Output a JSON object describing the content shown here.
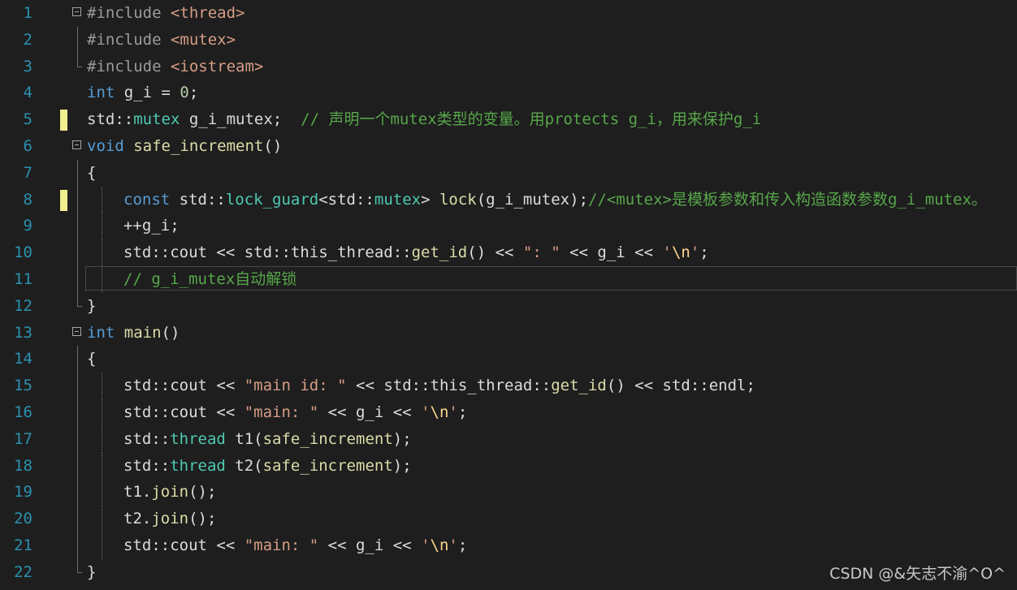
{
  "editor": {
    "lines": [
      {
        "n": "1",
        "fold": true,
        "tokens": [
          [
            "pp",
            "#include "
          ],
          [
            "hd",
            "<thread>"
          ]
        ]
      },
      {
        "n": "2",
        "tokens": [
          [
            "pp",
            "#include "
          ],
          [
            "hd",
            "<mutex>"
          ]
        ]
      },
      {
        "n": "3",
        "tokens": [
          [
            "pp",
            "#include "
          ],
          [
            "hd",
            "<iostream>"
          ]
        ]
      },
      {
        "n": "4",
        "tokens": [
          [
            "kw",
            "int"
          ],
          [
            "tx",
            " g_i = "
          ],
          [
            "nm",
            "0"
          ],
          [
            "tx",
            ";"
          ]
        ]
      },
      {
        "n": "5",
        "mark": true,
        "tokens": [
          [
            "tx",
            "std::"
          ],
          [
            "ty",
            "mutex"
          ],
          [
            "tx",
            " g_i_mutex;  "
          ],
          [
            "cm",
            "// 声明一个mutex类型的变量。用protects g_i，用来保护g_i"
          ]
        ]
      },
      {
        "n": "6",
        "fold": true,
        "tokens": [
          [
            "kw",
            "void"
          ],
          [
            "tx",
            " "
          ],
          [
            "fn",
            "safe_increment"
          ],
          [
            "tx",
            "()"
          ]
        ]
      },
      {
        "n": "7",
        "tokens": [
          [
            "tx",
            "{"
          ]
        ]
      },
      {
        "n": "8",
        "mark": true,
        "indent": true,
        "tokens": [
          [
            "kw",
            "const"
          ],
          [
            "tx",
            " std::"
          ],
          [
            "ty",
            "lock_guard"
          ],
          [
            "tx",
            "<std::"
          ],
          [
            "ty",
            "mutex"
          ],
          [
            "tx",
            "> "
          ],
          [
            "fn",
            "lock"
          ],
          [
            "tx",
            "(g_i_mutex);"
          ],
          [
            "cm",
            "//<mutex>是模板参数和传入构造函数参数g_i_mutex。"
          ]
        ]
      },
      {
        "n": "9",
        "indent": true,
        "tokens": [
          [
            "tx",
            "++g_i;"
          ]
        ]
      },
      {
        "n": "10",
        "indent": true,
        "tokens": [
          [
            "tx",
            "std::cout << std::this_thread::"
          ],
          [
            "fn",
            "get_id"
          ],
          [
            "tx",
            "() << "
          ],
          [
            "st",
            "\": \""
          ],
          [
            "tx",
            " << g_i << "
          ],
          [
            "st",
            "'"
          ],
          [
            "es",
            "\\n"
          ],
          [
            "st",
            "'"
          ],
          [
            "tx",
            ";"
          ]
        ]
      },
      {
        "n": "11",
        "indent": true,
        "current": true,
        "tokens": [
          [
            "cm",
            "// g_i_mutex自动解锁"
          ]
        ]
      },
      {
        "n": "12",
        "tokens": [
          [
            "tx",
            "}"
          ]
        ]
      },
      {
        "n": "13",
        "fold": true,
        "tokens": [
          [
            "kw",
            "int"
          ],
          [
            "tx",
            " "
          ],
          [
            "fn",
            "main"
          ],
          [
            "tx",
            "()"
          ]
        ]
      },
      {
        "n": "14",
        "tokens": [
          [
            "tx",
            "{"
          ]
        ]
      },
      {
        "n": "15",
        "indent": true,
        "tokens": [
          [
            "tx",
            "std::cout << "
          ],
          [
            "st",
            "\"main id: \""
          ],
          [
            "tx",
            " << std::this_thread::"
          ],
          [
            "fn",
            "get_id"
          ],
          [
            "tx",
            "() << std::endl;"
          ]
        ]
      },
      {
        "n": "16",
        "indent": true,
        "tokens": [
          [
            "tx",
            "std::cout << "
          ],
          [
            "st",
            "\"main: \""
          ],
          [
            "tx",
            " << g_i << "
          ],
          [
            "st",
            "'"
          ],
          [
            "es",
            "\\n"
          ],
          [
            "st",
            "'"
          ],
          [
            "tx",
            ";"
          ]
        ]
      },
      {
        "n": "17",
        "indent": true,
        "tokens": [
          [
            "tx",
            "std::"
          ],
          [
            "ty",
            "thread"
          ],
          [
            "tx",
            " t1("
          ],
          [
            "fn",
            "safe_increment"
          ],
          [
            "tx",
            ");"
          ]
        ]
      },
      {
        "n": "18",
        "indent": true,
        "tokens": [
          [
            "tx",
            "std::"
          ],
          [
            "ty",
            "thread"
          ],
          [
            "tx",
            " t2("
          ],
          [
            "fn",
            "safe_increment"
          ],
          [
            "tx",
            ");"
          ]
        ]
      },
      {
        "n": "19",
        "indent": true,
        "tokens": [
          [
            "tx",
            "t1."
          ],
          [
            "fn",
            "join"
          ],
          [
            "tx",
            "();"
          ]
        ]
      },
      {
        "n": "20",
        "indent": true,
        "tokens": [
          [
            "tx",
            "t2."
          ],
          [
            "fn",
            "join"
          ],
          [
            "tx",
            "();"
          ]
        ]
      },
      {
        "n": "21",
        "indent": true,
        "tokens": [
          [
            "tx",
            "std::cout << "
          ],
          [
            "st",
            "\"main: \""
          ],
          [
            "tx",
            " << g_i << "
          ],
          [
            "st",
            "'"
          ],
          [
            "es",
            "\\n"
          ],
          [
            "st",
            "'"
          ],
          [
            "tx",
            ";"
          ]
        ]
      },
      {
        "n": "22",
        "tokens": [
          [
            "tx",
            "}"
          ]
        ]
      }
    ]
  },
  "watermark": "CSDN @&矢志不渝^O^"
}
